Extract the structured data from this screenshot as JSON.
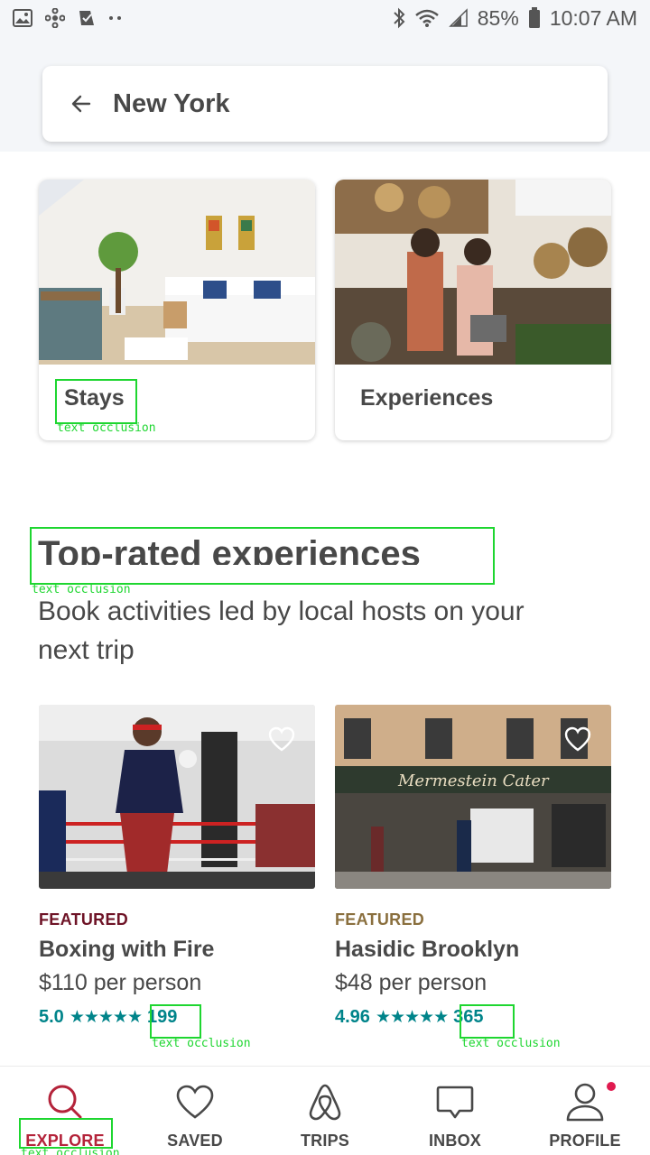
{
  "status_bar": {
    "battery": "85%",
    "time": "10:07 AM",
    "icons": [
      "image-icon",
      "pinwheel-icon",
      "task-check-icon",
      "more-dots-icon",
      "bluetooth-icon",
      "wifi-icon",
      "signal-icon",
      "battery-icon"
    ]
  },
  "search": {
    "city": "New York",
    "back_icon": "arrow-left-icon"
  },
  "categories": [
    {
      "label": "Stays",
      "occlusion": "text occlusion"
    },
    {
      "label": "Experiences"
    }
  ],
  "section": {
    "title": "Top-rated experiences",
    "title_occlusion": "text occlusion",
    "subtitle": "Book activities led by local hosts on your next trip"
  },
  "experiences": [
    {
      "tag": "FEATURED",
      "tag_color": "#6e1326",
      "title": "Boxing with Fire",
      "price": "$110 per person",
      "rating": "5.0",
      "stars": "★★★★★",
      "count": "199",
      "occlusion": "text occlusion"
    },
    {
      "tag": "FEATURED",
      "tag_color": "#8a6f3e",
      "title": "Hasidic Brooklyn",
      "price": "$48 per person",
      "rating": "4.96",
      "stars": "★★★★★",
      "count": "365",
      "occlusion": "text occlusion"
    }
  ],
  "nav": {
    "items": [
      {
        "label": "EXPLORE",
        "icon": "search-icon",
        "active": true,
        "occlusion": "text occlusion"
      },
      {
        "label": "SAVED",
        "icon": "heart-icon"
      },
      {
        "label": "TRIPS",
        "icon": "airbnb-logo-icon"
      },
      {
        "label": "INBOX",
        "icon": "message-icon"
      },
      {
        "label": "PROFILE",
        "icon": "person-icon",
        "badge": true
      }
    ],
    "accent": "#b4233a",
    "badge_color": "#e01a4f"
  },
  "colors": {
    "teal": "#00848a",
    "text": "#484848",
    "occlusion": "#1ed630"
  }
}
